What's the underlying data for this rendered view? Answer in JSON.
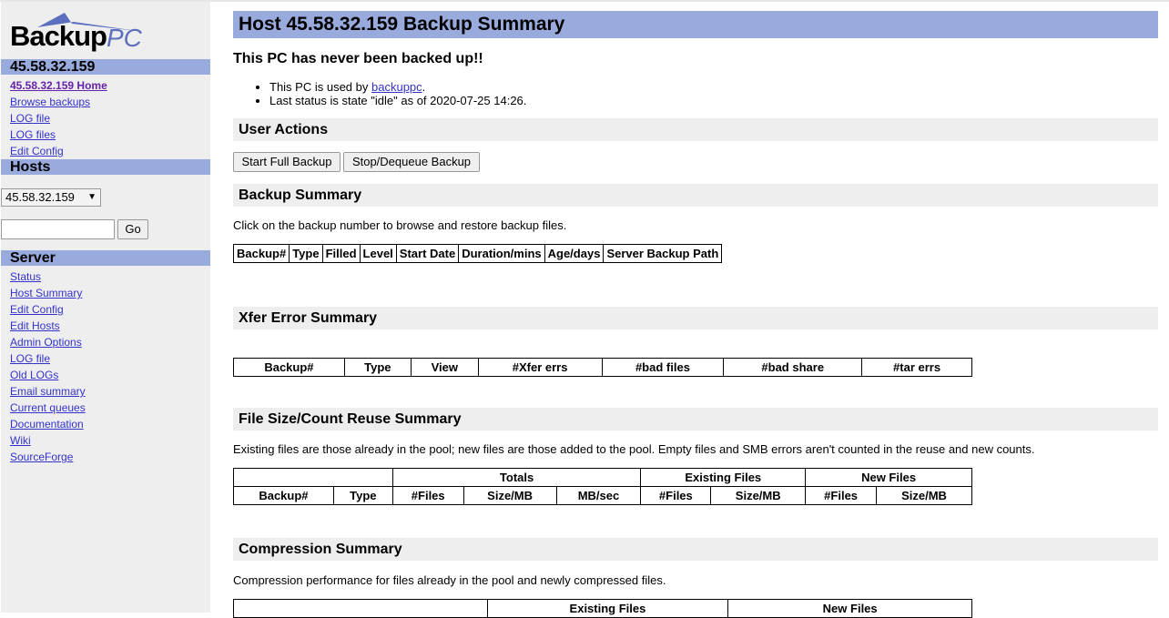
{
  "logo": {
    "main": "Backup",
    "pc": "PC"
  },
  "sidebar": {
    "host_header": "45.58.32.159",
    "host_links": [
      "45.58.32.159 Home",
      "Browse backups",
      "LOG file",
      "LOG files",
      "Edit Config"
    ],
    "hosts_header": "Hosts",
    "host_select_value": "45.58.32.159",
    "search_placeholder": "",
    "go_label": "Go",
    "server_header": "Server",
    "server_links": [
      "Status",
      "Host Summary",
      "Edit Config",
      "Edit Hosts",
      "Admin Options",
      "LOG file",
      "Old LOGs",
      "Email summary",
      "Current queues",
      "Documentation",
      "Wiki",
      "SourceForge"
    ]
  },
  "main": {
    "title": "Host 45.58.32.159 Backup Summary",
    "never_backed": "This PC has never been backed up!!",
    "info_used_by_prefix": "This PC is used by ",
    "info_used_by_link": "backuppc",
    "info_used_by_suffix": ".",
    "info_status": "Last status is state \"idle\" as of 2020-07-25 14:26.",
    "user_actions_title": "User Actions",
    "start_full_label": "Start Full Backup",
    "stop_dequeue_label": "Stop/Dequeue Backup",
    "backup_summary_title": "Backup Summary",
    "backup_summary_desc": "Click on the backup number to browse and restore backup files.",
    "backup_headers": [
      "Backup#",
      "Type",
      "Filled",
      "Level",
      "Start Date",
      "Duration/mins",
      "Age/days",
      "Server Backup Path"
    ],
    "xfer_title": "Xfer Error Summary",
    "xfer_headers": [
      "Backup#",
      "Type",
      "View",
      "#Xfer errs",
      "#bad files",
      "#bad share",
      "#tar errs"
    ],
    "filesize_title": "File Size/Count Reuse Summary",
    "filesize_desc": "Existing files are those already in the pool; new files are those added to the pool. Empty files and SMB errors aren't counted in the reuse and new counts.",
    "filesize_groups": [
      "Totals",
      "Existing Files",
      "New Files"
    ],
    "filesize_headers": [
      "Backup#",
      "Type",
      "#Files",
      "Size/MB",
      "MB/sec",
      "#Files",
      "Size/MB",
      "#Files",
      "Size/MB"
    ],
    "compression_title": "Compression Summary",
    "compression_desc": "Compression performance for files already in the pool and newly compressed files.",
    "compression_groups": [
      "Existing Files",
      "New Files"
    ]
  },
  "colors": {
    "header_blue": "#99aadd",
    "sidebar_gray": "#eeeeee",
    "link": "#3333cc"
  }
}
